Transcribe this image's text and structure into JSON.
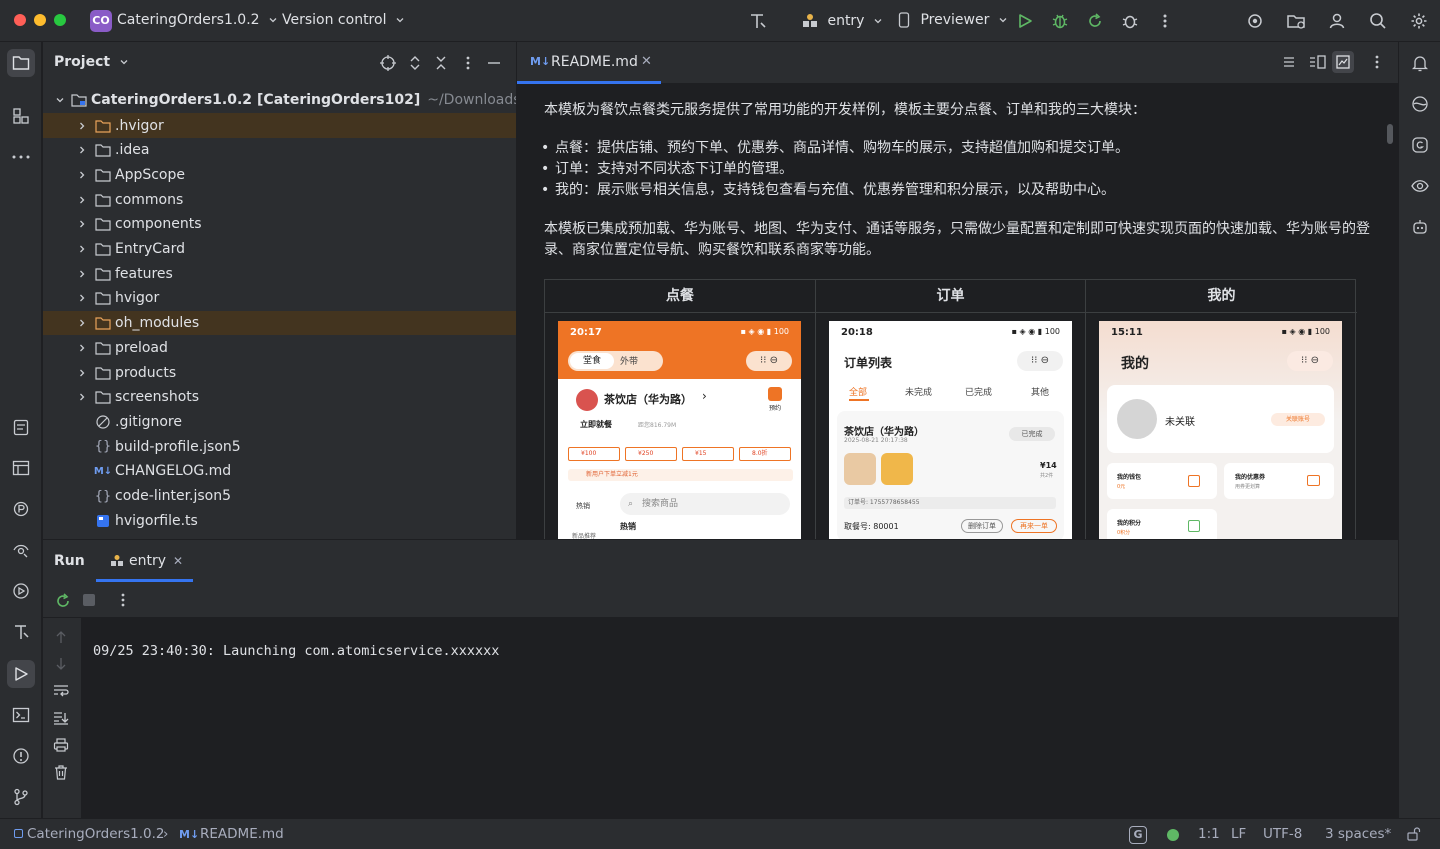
{
  "titlebar": {
    "project_badge": "CO",
    "project_name": "CateringOrders1.0.2",
    "vcs": "Version control",
    "run_config": "entry",
    "device": "Previewer"
  },
  "project_panel": {
    "title": "Project",
    "root": {
      "name": "CateringOrders1.0.2",
      "module": "[CateringOrders102]",
      "path": "~/Downloads/CateringO"
    },
    "items": [
      {
        "name": ".hvigor",
        "type": "folder",
        "highlight": true
      },
      {
        "name": ".idea",
        "type": "folder"
      },
      {
        "name": "AppScope",
        "type": "folder"
      },
      {
        "name": "commons",
        "type": "folder"
      },
      {
        "name": "components",
        "type": "folder"
      },
      {
        "name": "EntryCard",
        "type": "folder"
      },
      {
        "name": "features",
        "type": "folder"
      },
      {
        "name": "hvigor",
        "type": "folder"
      },
      {
        "name": "oh_modules",
        "type": "folder",
        "highlight": true
      },
      {
        "name": "preload",
        "type": "folder"
      },
      {
        "name": "products",
        "type": "folder"
      },
      {
        "name": "screenshots",
        "type": "folder"
      },
      {
        "name": ".gitignore",
        "type": "ignore"
      },
      {
        "name": "build-profile.json5",
        "type": "json"
      },
      {
        "name": "CHANGELOG.md",
        "type": "md"
      },
      {
        "name": "code-linter.json5",
        "type": "json"
      },
      {
        "name": "hvigorfile.ts",
        "type": "ts"
      }
    ]
  },
  "editor": {
    "tab_label": "README.md",
    "tab_badge": "M↓",
    "intro": "本模板为餐饮点餐类元服务提供了常用功能的开发样例，模板主要分点餐、订单和我的三大模块：",
    "bullets": [
      "点餐：提供店铺、预约下单、优惠券、商品详情、购物车的展示，支持超值加购和提交订单。",
      "订单：支持对不同状态下订单的管理。",
      "我的：展示账号相关信息，支持钱包查看与充值、优惠券管理和积分展示，以及帮助中心。"
    ],
    "para2_line1": "本模板已集成预加载、华为账号、地图、华为支付、通话等服务，只需做少量配置和定制即可快速实现页面的快速加载、华为账号的登",
    "para2_line2": "录、商家位置定位导航、购买餐饮和联系商家等功能。",
    "table_headers": [
      "点餐",
      "订单",
      "我的"
    ],
    "phone1": {
      "time": "20:17",
      "tab_dine": "堂食",
      "tab_takeout": "外带",
      "store": "茶饮店（华为路）",
      "order_now": "立即就餐",
      "distance": "距您816.79M",
      "reserve": "预约",
      "coupons": [
        "¥100",
        "¥250",
        "¥15",
        "8.0折"
      ],
      "new_user": "新用户下单立减1元",
      "hot": "热销",
      "search": "搜索商品",
      "hot2": "热销",
      "new": "新品推荐"
    },
    "phone2": {
      "time": "20:18",
      "title": "订单列表",
      "tabs": [
        "全部",
        "未完成",
        "已完成",
        "其他"
      ],
      "store": "茶饮店（华为路）",
      "date": "2025-08-21 20:17:38",
      "status": "已完成",
      "price": "¥14",
      "count": "共2件",
      "order_no": "订单号: 1755778658455",
      "pickup": "取餐号: 80001",
      "delete": "删除订单",
      "reorder": "再来一单"
    },
    "phone3": {
      "time": "15:11",
      "title": "我的",
      "user": "未关联",
      "link": "关联账号",
      "wallet": "我的钱包",
      "wallet_val": "0元",
      "coupon": "我的优惠券",
      "coupon_sub": "用券更划算",
      "points": "我的积分",
      "points_val": "0积分"
    }
  },
  "run_panel": {
    "title": "Run",
    "tab": "entry",
    "log": "09/25 23:40:30: Launching com.atomicservice.xxxxxx"
  },
  "statusbar": {
    "project": "CateringOrders1.0.2",
    "file": "README.md",
    "position": "1:1",
    "line_sep": "LF",
    "encoding": "UTF-8",
    "indent": "3 spaces*"
  },
  "colors": {
    "bg": "#1e1f22",
    "panel": "#2b2d30",
    "accent": "#3574f0",
    "orange": "#e8731f",
    "run_green": "#5fb865"
  }
}
